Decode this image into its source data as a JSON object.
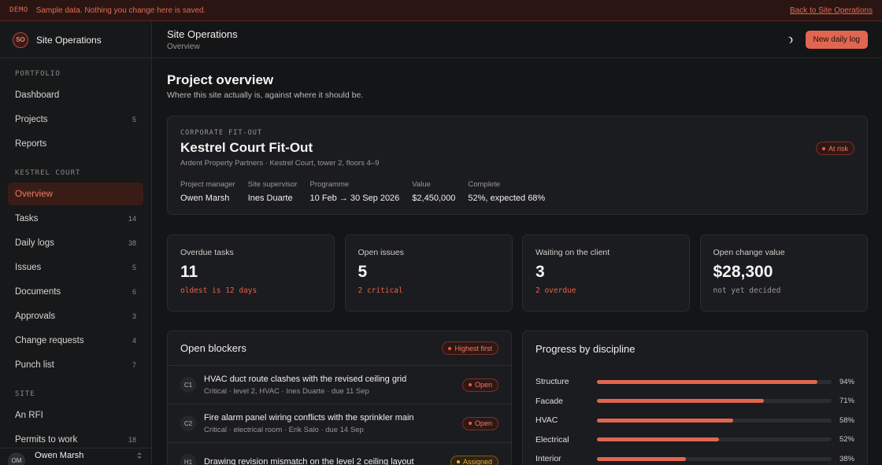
{
  "demo": {
    "tag": "DEMO",
    "text": "Sample data. Nothing you change here is saved.",
    "link": "Back to Site Operations"
  },
  "brand": {
    "initials": "SO",
    "name": "Site Operations"
  },
  "sidebar": {
    "sections": [
      {
        "label": "PORTFOLIO",
        "items": [
          {
            "label": "Dashboard",
            "count": ""
          },
          {
            "label": "Projects",
            "count": "5"
          },
          {
            "label": "Reports",
            "count": ""
          }
        ]
      },
      {
        "label": "KESTREL COURT",
        "items": [
          {
            "label": "Overview",
            "count": ""
          },
          {
            "label": "Tasks",
            "count": "14"
          },
          {
            "label": "Daily logs",
            "count": "38"
          },
          {
            "label": "Issues",
            "count": "5"
          },
          {
            "label": "Documents",
            "count": "6"
          },
          {
            "label": "Approvals",
            "count": "3"
          },
          {
            "label": "Change requests",
            "count": "4"
          },
          {
            "label": "Punch list",
            "count": "7"
          }
        ]
      },
      {
        "label": "SITE",
        "items": [
          {
            "label": "An RFI",
            "count": ""
          },
          {
            "label": "Permits to work",
            "count": "18"
          }
        ]
      }
    ],
    "active": "Overview",
    "user": {
      "initials": "OM",
      "name": "Owen Marsh"
    }
  },
  "header": {
    "title": "Site Operations",
    "subtitle": "Overview",
    "primary_button": "New daily log",
    "theme_icon": "moon-icon"
  },
  "page": {
    "title": "Project overview",
    "subtitle": "Where this site actually is, against where it should be."
  },
  "project": {
    "kicker": "CORPORATE FIT-OUT",
    "name": "Kestrel Court Fit-Out",
    "client": "Ardent Property Partners · Kestrel Court, tower 2, floors 4–9",
    "status": "At risk",
    "meta": [
      {
        "label": "Project manager",
        "value": "Owen Marsh"
      },
      {
        "label": "Site supervisor",
        "value": "Ines Duarte"
      },
      {
        "label": "Programme",
        "value": "10 Feb → 30 Sep 2026"
      },
      {
        "label": "Value",
        "value": "$2,450,000"
      },
      {
        "label": "Complete",
        "value": "52%, expected 68%"
      }
    ]
  },
  "stats": [
    {
      "label": "Overdue tasks",
      "value": "11",
      "note": "oldest is 12 days",
      "tone": "alert"
    },
    {
      "label": "Open issues",
      "value": "5",
      "note": "2 critical",
      "tone": "alert"
    },
    {
      "label": "Waiting on the client",
      "value": "3",
      "note": "2 overdue",
      "tone": "alert"
    },
    {
      "label": "Open change value",
      "value": "$28,300",
      "note": "not yet decided",
      "tone": "muted"
    }
  ],
  "blockers": {
    "title": "Open blockers",
    "sort_label": "Highest first",
    "items": [
      {
        "code": "C1",
        "title": "HVAC duct route clashes with the revised ceiling grid",
        "meta": "Critical · level 2, HVAC · Ines Duarte · due 11 Sep",
        "status": "Open",
        "tone": "red"
      },
      {
        "code": "C2",
        "title": "Fire alarm panel wiring conflicts with the sprinkler main",
        "meta": "Critical · electrical room · Erik Salo · due 14 Sep",
        "status": "Open",
        "tone": "red"
      },
      {
        "code": "H1",
        "title": "Drawing revision mismatch on the level 2 ceiling layout",
        "meta": "",
        "status": "Assigned",
        "tone": "amber"
      }
    ]
  },
  "progress": {
    "title": "Progress by discipline",
    "items": [
      {
        "name": "Structure",
        "pct": 94,
        "label": "94%"
      },
      {
        "name": "Facade",
        "pct": 71,
        "label": "71%"
      },
      {
        "name": "HVAC",
        "pct": 58,
        "label": "58%"
      },
      {
        "name": "Electrical",
        "pct": 52,
        "label": "52%"
      },
      {
        "name": "Interior",
        "pct": 38,
        "label": "38%"
      }
    ]
  },
  "colors": {
    "accent": "#e06650",
    "alert": "#e8604b",
    "amber": "#e6b04c",
    "background": "#141517"
  }
}
